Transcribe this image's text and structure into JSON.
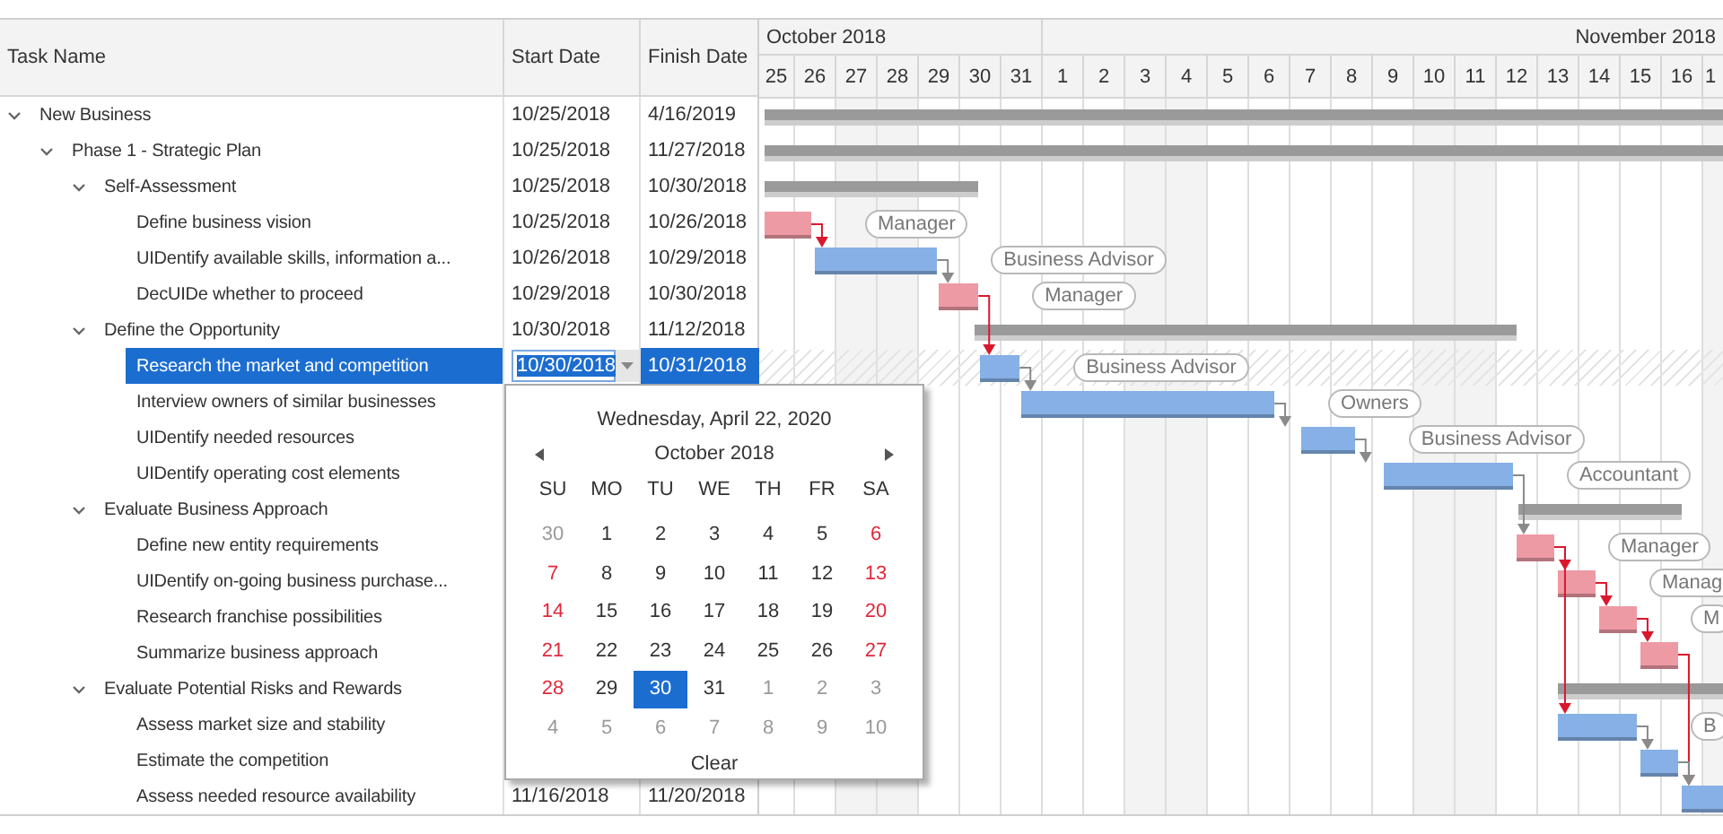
{
  "columns": [
    "Task Name",
    "Start Date",
    "Finish Date"
  ],
  "timeline": {
    "months": [
      {
        "label": "October 2018",
        "days": [
          {
            "label": "25",
            "weekend": false
          },
          {
            "label": "26",
            "weekend": false
          },
          {
            "label": "27",
            "weekend": true
          },
          {
            "label": "28",
            "weekend": true
          },
          {
            "label": "29",
            "weekend": false
          },
          {
            "label": "30",
            "weekend": false
          },
          {
            "label": "31",
            "weekend": false
          }
        ]
      },
      {
        "label": "November 2018",
        "days": [
          {
            "label": "1",
            "weekend": false
          },
          {
            "label": "2",
            "weekend": false
          },
          {
            "label": "3",
            "weekend": true
          },
          {
            "label": "4",
            "weekend": true
          },
          {
            "label": "5",
            "weekend": false
          },
          {
            "label": "6",
            "weekend": false
          },
          {
            "label": "7",
            "weekend": false
          },
          {
            "label": "8",
            "weekend": false
          },
          {
            "label": "9",
            "weekend": false
          },
          {
            "label": "10",
            "weekend": true
          },
          {
            "label": "11",
            "weekend": true
          },
          {
            "label": "12",
            "weekend": false
          },
          {
            "label": "13",
            "weekend": false
          },
          {
            "label": "14",
            "weekend": false
          },
          {
            "label": "15",
            "weekend": false
          },
          {
            "label": "16",
            "weekend": false
          },
          {
            "label": "1",
            "weekend": true
          }
        ]
      }
    ]
  },
  "tasks": [
    {
      "name": "New Business",
      "start": "10/25/2018",
      "finish": "4/16/2019",
      "kind": "summary",
      "expanded": true,
      "selected": false,
      "children": [
        {
          "name": "Phase 1 - Strategic Plan",
          "start": "10/25/2018",
          "finish": "11/27/2018",
          "kind": "summary",
          "expanded": true,
          "selected": false,
          "children": [
            {
              "name": "Self-Assessment",
              "start": "10/25/2018",
              "finish": "10/30/2018",
              "kind": "summary",
              "expanded": true,
              "selected": false,
              "children": [
                {
                  "name": "Define business vision",
                  "start": "10/25/2018",
                  "finish": "10/26/2018",
                  "kind": "task",
                  "critical": true,
                  "resource": "Manager",
                  "selected": false
                },
                {
                  "name": "UIDentify available skills, information a...",
                  "start": "10/26/2018",
                  "finish": "10/29/2018",
                  "kind": "task",
                  "critical": false,
                  "resource": "Business Advisor",
                  "selected": false
                },
                {
                  "name": "DecUIDe whether to proceed",
                  "start": "10/29/2018",
                  "finish": "10/30/2018",
                  "kind": "task",
                  "critical": true,
                  "resource": "Manager",
                  "selected": false
                }
              ]
            },
            {
              "name": "Define the Opportunity",
              "start": "10/30/2018",
              "finish": "11/12/2018",
              "kind": "summary",
              "expanded": true,
              "selected": false,
              "children": [
                {
                  "name": "Research the market and competition",
                  "start": "10/30/2018",
                  "finish": "10/31/2018",
                  "kind": "task",
                  "critical": false,
                  "resource": "Business Advisor",
                  "selected": true
                },
                {
                  "name": "Interview owners of similar businesses",
                  "kind": "task",
                  "critical": false,
                  "resource": "Owners",
                  "selected": false
                },
                {
                  "name": "UIDentify needed resources",
                  "kind": "task",
                  "critical": false,
                  "resource": "Business Advisor",
                  "selected": false
                },
                {
                  "name": "UIDentify operating cost elements",
                  "kind": "task",
                  "critical": false,
                  "resource": "Accountant",
                  "selected": false
                }
              ]
            },
            {
              "name": "Evaluate Business Approach",
              "kind": "summary",
              "expanded": true,
              "selected": false,
              "children": [
                {
                  "name": "Define new entity requirements",
                  "kind": "task",
                  "critical": true,
                  "resource": "Manager",
                  "selected": false
                },
                {
                  "name": "UIDentify on-going business purchase...",
                  "kind": "task",
                  "critical": true,
                  "resource": "Manag",
                  "selected": false
                },
                {
                  "name": "Research franchise possibilities",
                  "kind": "task",
                  "critical": true,
                  "resource": "M",
                  "selected": false
                },
                {
                  "name": "Summarize business approach",
                  "kind": "task",
                  "critical": true,
                  "selected": false
                }
              ]
            },
            {
              "name": "Evaluate Potential Risks and Rewards",
              "kind": "summary",
              "expanded": true,
              "selected": false,
              "children": [
                {
                  "name": "Assess market size and stability",
                  "kind": "task",
                  "critical": false,
                  "resource": "B",
                  "selected": false
                },
                {
                  "name": "Estimate the competition",
                  "kind": "task",
                  "critical": false,
                  "selected": false
                },
                {
                  "name": "Assess needed resource availability",
                  "start": "11/16/2018",
                  "finish": "11/20/2018",
                  "kind": "task",
                  "critical": false,
                  "selected": false
                }
              ]
            }
          ]
        }
      ]
    }
  ],
  "date_picker": {
    "today": "Wednesday, April 22, 2020",
    "month": "October 2018",
    "weekdays": [
      "SU",
      "MO",
      "TU",
      "WE",
      "TH",
      "FR",
      "SA"
    ],
    "weeks": [
      [
        {
          "day": "30",
          "kind": "other",
          "selected": false
        },
        {
          "day": "1",
          "kind": "day",
          "selected": false
        },
        {
          "day": "2",
          "kind": "day",
          "selected": false
        },
        {
          "day": "3",
          "kind": "day",
          "selected": false
        },
        {
          "day": "4",
          "kind": "day",
          "selected": false
        },
        {
          "day": "5",
          "kind": "day",
          "selected": false
        },
        {
          "day": "6",
          "kind": "weekend",
          "selected": false
        }
      ],
      [
        {
          "day": "7",
          "kind": "weekend",
          "selected": false
        },
        {
          "day": "8",
          "kind": "day",
          "selected": false
        },
        {
          "day": "9",
          "kind": "day",
          "selected": false
        },
        {
          "day": "10",
          "kind": "day",
          "selected": false
        },
        {
          "day": "11",
          "kind": "day",
          "selected": false
        },
        {
          "day": "12",
          "kind": "day",
          "selected": false
        },
        {
          "day": "13",
          "kind": "weekend",
          "selected": false
        }
      ],
      [
        {
          "day": "14",
          "kind": "weekend",
          "selected": false
        },
        {
          "day": "15",
          "kind": "day",
          "selected": false
        },
        {
          "day": "16",
          "kind": "day",
          "selected": false
        },
        {
          "day": "17",
          "kind": "day",
          "selected": false
        },
        {
          "day": "18",
          "kind": "day",
          "selected": false
        },
        {
          "day": "19",
          "kind": "day",
          "selected": false
        },
        {
          "day": "20",
          "kind": "weekend",
          "selected": false
        }
      ],
      [
        {
          "day": "21",
          "kind": "weekend",
          "selected": false
        },
        {
          "day": "22",
          "kind": "day",
          "selected": false
        },
        {
          "day": "23",
          "kind": "day",
          "selected": false
        },
        {
          "day": "24",
          "kind": "day",
          "selected": false
        },
        {
          "day": "25",
          "kind": "day",
          "selected": false
        },
        {
          "day": "26",
          "kind": "day",
          "selected": false
        },
        {
          "day": "27",
          "kind": "weekend",
          "selected": false
        }
      ],
      [
        {
          "day": "28",
          "kind": "weekend",
          "selected": false
        },
        {
          "day": "29",
          "kind": "day",
          "selected": false
        },
        {
          "day": "30",
          "kind": "day",
          "selected": true
        },
        {
          "day": "31",
          "kind": "day",
          "selected": false
        },
        {
          "day": "1",
          "kind": "other",
          "selected": false
        },
        {
          "day": "2",
          "kind": "other",
          "selected": false
        },
        {
          "day": "3",
          "kind": "other",
          "selected": false
        }
      ],
      [
        {
          "day": "4",
          "kind": "other",
          "selected": false
        },
        {
          "day": "5",
          "kind": "other",
          "selected": false
        },
        {
          "day": "6",
          "kind": "other",
          "selected": false
        },
        {
          "day": "7",
          "kind": "other",
          "selected": false
        },
        {
          "day": "8",
          "kind": "other",
          "selected": false
        },
        {
          "day": "9",
          "kind": "other",
          "selected": false
        },
        {
          "day": "10",
          "kind": "other",
          "selected": false
        }
      ]
    ],
    "clear": "Clear"
  }
}
